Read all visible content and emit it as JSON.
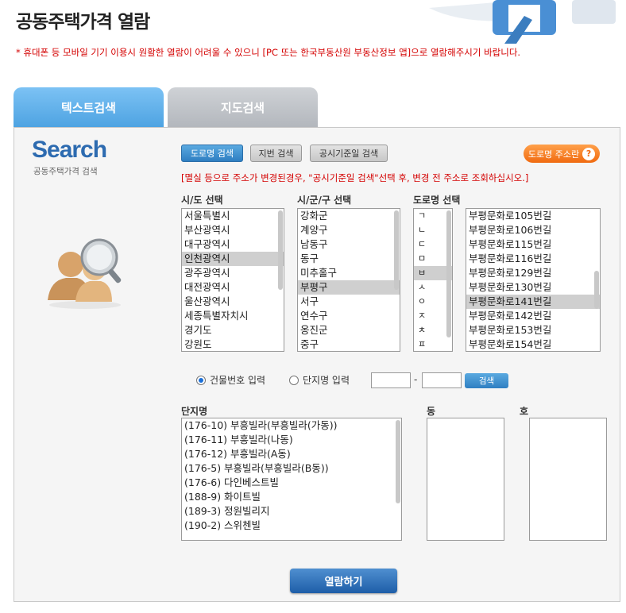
{
  "page": {
    "title": "공동주택가격 열람",
    "notice": "* 휴대폰 등 모바일 기기 이용시 원활한 열람이 어려울 수 있으니 [PC 또는 한국부동산원 부동산정보 앱]으로 열람해주시기 바랍니다."
  },
  "tabs": {
    "text_search": "텍스트검색",
    "map_search": "지도검색"
  },
  "search_logo": {
    "title": "Search",
    "subtitle": "공동주택가격 검색"
  },
  "buttons": {
    "road_search": "도로명 검색",
    "lot_search": "지번 검색",
    "date_search": "공시기준일 검색",
    "road_help": "도로명 주소란",
    "search": "검색",
    "view": "열람하기"
  },
  "warning": "[멸실 등으로 주소가 변경된경우, \"공시기준일 검색\"선택 후, 변경 전 주소로 조회하십시오.]",
  "columns": {
    "sido": "시/도 선택",
    "sigungu": "시/군/구 선택",
    "road": "도로명 선택"
  },
  "sido_items": [
    "서울특별시",
    "부산광역시",
    "대구광역시",
    "인천광역시",
    "광주광역시",
    "대전광역시",
    "울산광역시",
    "세종특별자치시",
    "경기도",
    "강원도"
  ],
  "sido_selected": 3,
  "sigungu_items": [
    "강화군",
    "계양구",
    "남동구",
    "동구",
    "미추홀구",
    "부평구",
    "서구",
    "연수구",
    "옹진군",
    "중구"
  ],
  "sigungu_selected": 5,
  "initial_items": [
    "ㄱ",
    "ㄴ",
    "ㄷ",
    "ㅁ",
    "ㅂ",
    "ㅅ",
    "ㅇ",
    "ㅈ",
    "ㅊ",
    "ㅍ"
  ],
  "initial_selected": 4,
  "road_items": [
    "부평문화로105번길",
    "부평문화로106번길",
    "부평문화로115번길",
    "부평문화로116번길",
    "부평문화로129번길",
    "부평문화로130번길",
    "부평문화로141번길",
    "부평문화로142번길",
    "부평문화로153번길",
    "부평문화로154번길"
  ],
  "road_selected": 6,
  "radios": {
    "building": "건물번호 입력",
    "complex": "단지명 입력",
    "building_checked": true
  },
  "result_labels": {
    "complex": "단지명",
    "dong": "동",
    "ho": "호"
  },
  "complex_items": [
    "(176-10) 부흥빌라(부흥빌라(가동))",
    "(176-11) 부흥빌라(나동)",
    "(176-12) 부흥빌라(A동)",
    "(176-5) 부흥빌라(부흥빌라(B동))",
    "(176-6) 다인베스트빌",
    "(188-9) 화이트빌",
    "(189-3) 정원빌리지",
    "(190-2) 스위첸빌"
  ],
  "colors": {
    "accent_blue": "#2f7fc2",
    "warning_red": "#d40000",
    "help_orange": "#f06a10"
  }
}
